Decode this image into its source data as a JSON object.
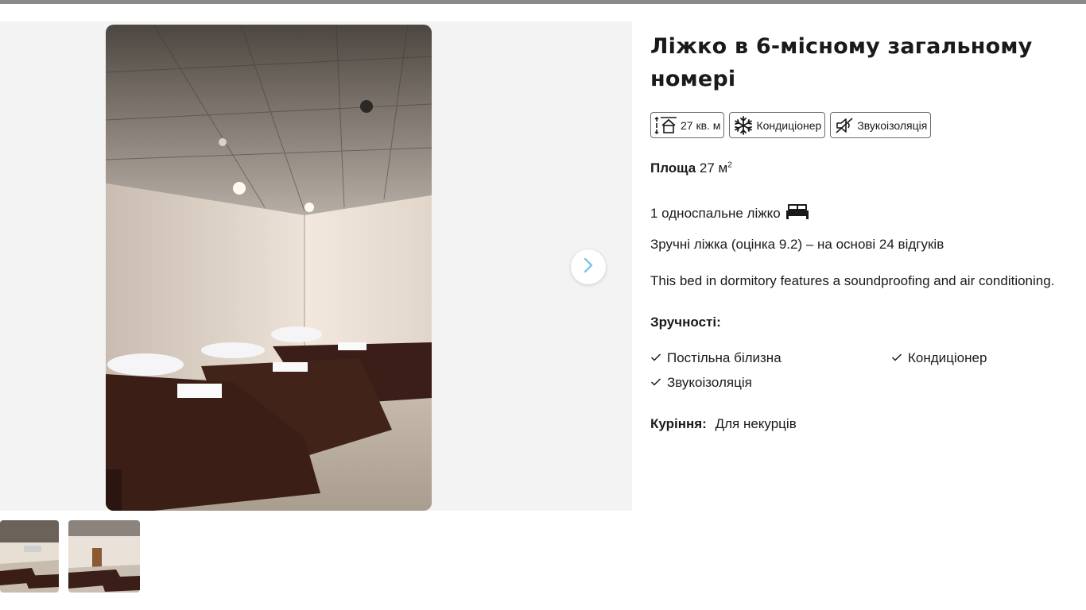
{
  "room": {
    "title": "Ліжко в 6-місному загальному номері",
    "badges": [
      {
        "icon": "room-size-icon",
        "label": "27 кв. м"
      },
      {
        "icon": "snowflake-icon",
        "label": "Кондиціонер"
      },
      {
        "icon": "soundproof-icon",
        "label": "Звукоізоляція"
      }
    ],
    "area": {
      "label": "Площа",
      "value": "27 м",
      "unit_sup": "2"
    },
    "beds": {
      "text": "1 односпальне ліжко",
      "icon": "bed-icon"
    },
    "rating_text": "Зручні ліжка (оцінка 9.2) – на основі 24 відгуків",
    "description": "This bed in dormitory features a soundproofing and air conditioning.",
    "facilities": {
      "heading": "Зручності:",
      "items": [
        "Постільна білизна",
        "Кондиціонер",
        "Звукоізоляція"
      ]
    },
    "smoking": {
      "label": "Куріння:",
      "value": "Для некурців"
    }
  },
  "gallery": {
    "next_icon": "chevron-right-icon",
    "accent_color": "#7fc3e6"
  }
}
